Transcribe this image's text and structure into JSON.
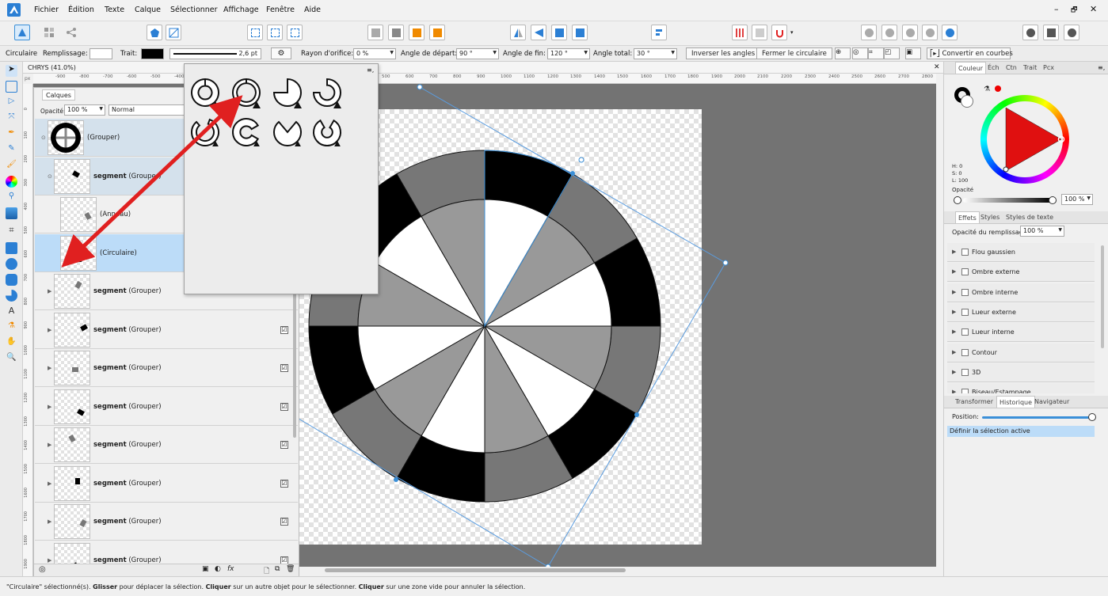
{
  "menu": {
    "items": [
      "Fichier",
      "Édition",
      "Texte",
      "Calque",
      "Sélectionner",
      "Affichage",
      "Fenêtre",
      "Aide"
    ],
    "window_controls": [
      "–",
      "🗗",
      "✕"
    ]
  },
  "context_bar": {
    "tool_name": "Circulaire",
    "fill_label": "Remplissage:",
    "stroke_label": "Trait:",
    "stroke_width": "2,6 pt",
    "hole_radius_label": "Rayon d'orifice:",
    "hole_radius_value": "0 %",
    "start_angle_label": "Angle de départ:",
    "start_angle_value": "90 °",
    "end_angle_label": "Angle de fin:",
    "end_angle_value": "120 °",
    "total_angle_label": "Angle total:",
    "total_angle_value": "30 °",
    "invert_button": "Inverser les angles",
    "close_button": "Fermer le circulaire",
    "convert_button": "Convertir en courbes"
  },
  "document": {
    "tab_title": "CHRYS (41.0%)",
    "ruler_unit": "px",
    "ruler_h_ticks": [
      "-900",
      "-800",
      "-700",
      "-600",
      "-500",
      "-400",
      "500",
      "600",
      "700",
      "800",
      "900",
      "1000",
      "1100",
      "1200",
      "1300",
      "1400",
      "1500",
      "1600",
      "1700",
      "1800",
      "1900",
      "2000",
      "2100",
      "2200",
      "2300",
      "2400",
      "2500",
      "2600",
      "2700",
      "2800"
    ],
    "ruler_v_ticks": [
      "0",
      "100",
      "200",
      "300",
      "400",
      "500",
      "600",
      "700",
      "800",
      "900",
      "1000",
      "1100",
      "1200",
      "1300",
      "1400",
      "1500",
      "1600",
      "1700",
      "1800",
      "1900"
    ]
  },
  "layers_panel": {
    "tab": "Calques",
    "opacity_label": "Opacité:",
    "opacity_value": "100 %",
    "blend_mode": "Normal",
    "rows": [
      {
        "bold": "",
        "suffix": "(Grouper)"
      },
      {
        "bold": "segment",
        "suffix": " (Grouper)"
      },
      {
        "bold": "",
        "suffix": "(Anneau)"
      },
      {
        "bold": "",
        "suffix": "(Circulaire)"
      },
      {
        "bold": "segment",
        "suffix": " (Grouper)"
      },
      {
        "bold": "segment",
        "suffix": " (Grouper)"
      },
      {
        "bold": "segment",
        "suffix": " (Grouper)"
      },
      {
        "bold": "segment",
        "suffix": " (Grouper)"
      },
      {
        "bold": "segment",
        "suffix": " (Grouper)"
      },
      {
        "bold": "segment",
        "suffix": " (Grouper)"
      },
      {
        "bold": "segment",
        "suffix": " (Grouper)"
      },
      {
        "bold": "segment",
        "suffix": " (Grouper)"
      }
    ],
    "checkmark": "☑",
    "fx_label": "fx"
  },
  "popup": {
    "menu_glyph": "≡,"
  },
  "right_panel": {
    "color_tabs": [
      "Couleur",
      "Éch",
      "Ctn",
      "Trait",
      "Pcx"
    ],
    "hsl": [
      "H: 0",
      "S: 0",
      "L: 100"
    ],
    "opacity_label": "Opacité",
    "opacity_value": "100 %",
    "fx_tabs": [
      "Effets",
      "Styles",
      "Styles de texte"
    ],
    "fill_opacity_label": "Opacité du remplissage:",
    "fill_opacity_value": "100 %",
    "effects": [
      "Flou gaussien",
      "Ombre externe",
      "Ombre interne",
      "Lueur externe",
      "Lueur interne",
      "Contour",
      "3D",
      "Biseau/Estampage"
    ],
    "history_tabs": [
      "Transformer",
      "Historique",
      "Navigateur"
    ],
    "position_label": "Position:",
    "history_items": [
      "Définir la sélection active"
    ]
  },
  "status": {
    "parts": [
      {
        "t": "\"Circulaire\" sélectionné(s). ",
        "b": false
      },
      {
        "t": "Glisser",
        "b": true
      },
      {
        "t": " pour déplacer la sélection. ",
        "b": false
      },
      {
        "t": "Cliquer",
        "b": true
      },
      {
        "t": " sur un autre objet pour le sélectionner. ",
        "b": false
      },
      {
        "t": "Cliquer",
        "b": true
      },
      {
        "t": " sur une zone vide pour annuler la sélection.",
        "b": false
      }
    ]
  },
  "colors": {
    "accent": "#3a8fd8",
    "selection": "#bcdcf8",
    "arrow": "#e02020"
  }
}
